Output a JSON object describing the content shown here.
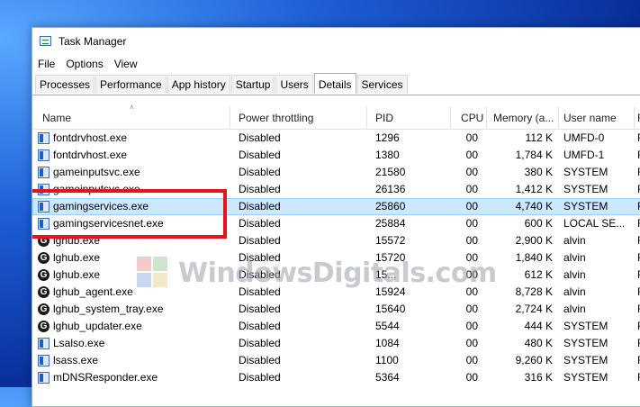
{
  "window": {
    "title": "Task Manager"
  },
  "menu": [
    "File",
    "Options",
    "View"
  ],
  "tabs": [
    "Processes",
    "Performance",
    "App history",
    "Startup",
    "Users",
    "Details",
    "Services"
  ],
  "active_tab": "Details",
  "columns": [
    "Name",
    "Power throttling",
    "PID",
    "CPU",
    "Memory (a...",
    "User name",
    "R"
  ],
  "rows": [
    {
      "name": "fontdrvhost.exe",
      "icon": "window-process-icon",
      "power": "Disabled",
      "pid": "1296",
      "cpu": "00",
      "mem": "112 K",
      "user": "UMFD-0",
      "last": "R"
    },
    {
      "name": "fontdrvhost.exe",
      "icon": "window-process-icon",
      "power": "Disabled",
      "pid": "1380",
      "cpu": "00",
      "mem": "1,784 K",
      "user": "UMFD-1",
      "last": "R"
    },
    {
      "name": "gameinputsvc.exe",
      "icon": "window-process-icon",
      "power": "Disabled",
      "pid": "21580",
      "cpu": "00",
      "mem": "380 K",
      "user": "SYSTEM",
      "last": "R"
    },
    {
      "name": "gameinputsvc.exe",
      "icon": "window-process-icon",
      "power": "Disabled",
      "pid": "26136",
      "cpu": "00",
      "mem": "1,412 K",
      "user": "SYSTEM",
      "last": "R"
    },
    {
      "name": "gamingservices.exe",
      "icon": "window-process-icon",
      "power": "Disabled",
      "pid": "25860",
      "cpu": "00",
      "mem": "4,740 K",
      "user": "SYSTEM",
      "last": "R"
    },
    {
      "name": "gamingservicesnet.exe",
      "icon": "window-process-icon",
      "power": "Disabled",
      "pid": "25884",
      "cpu": "00",
      "mem": "600 K",
      "user": "LOCAL SE...",
      "last": "R"
    },
    {
      "name": "lghub.exe",
      "icon": "logitech-g-icon",
      "power": "Disabled",
      "pid": "15572",
      "cpu": "00",
      "mem": "2,900 K",
      "user": "alvin",
      "last": "R"
    },
    {
      "name": "lghub.exe",
      "icon": "logitech-g-icon",
      "power": "Disabled",
      "pid": "15720",
      "cpu": "00",
      "mem": "1,840 K",
      "user": "alvin",
      "last": "R"
    },
    {
      "name": "lghub.exe",
      "icon": "logitech-g-icon",
      "power": "Disabled",
      "pid": "15...",
      "cpu": "00",
      "mem": "612 K",
      "user": "alvin",
      "last": "R"
    },
    {
      "name": "lghub_agent.exe",
      "icon": "logitech-g-icon",
      "power": "Disabled",
      "pid": "15924",
      "cpu": "00",
      "mem": "8,728 K",
      "user": "alvin",
      "last": "R"
    },
    {
      "name": "lghub_system_tray.exe",
      "icon": "logitech-g-icon",
      "power": "Disabled",
      "pid": "15640",
      "cpu": "00",
      "mem": "2,724 K",
      "user": "alvin",
      "last": "R"
    },
    {
      "name": "lghub_updater.exe",
      "icon": "logitech-g-icon",
      "power": "Disabled",
      "pid": "5544",
      "cpu": "00",
      "mem": "444 K",
      "user": "SYSTEM",
      "last": "R"
    },
    {
      "name": "Lsalso.exe",
      "icon": "window-process-icon",
      "power": "Disabled",
      "pid": "1084",
      "cpu": "00",
      "mem": "480 K",
      "user": "SYSTEM",
      "last": "R"
    },
    {
      "name": "lsass.exe",
      "icon": "window-process-icon",
      "power": "Disabled",
      "pid": "1100",
      "cpu": "00",
      "mem": "9,260 K",
      "user": "SYSTEM",
      "last": "R"
    },
    {
      "name": "mDNSResponder.exe",
      "icon": "window-process-icon",
      "power": "Disabled",
      "pid": "5364",
      "cpu": "00",
      "mem": "316 K",
      "user": "SYSTEM",
      "last": "R"
    }
  ],
  "selected_row": 4,
  "watermark": "WindowsDigitals.com",
  "colors": {
    "selection": "#cce8ff",
    "highlight_box": "#e3151b",
    "desktop": "#1e5fd8"
  }
}
